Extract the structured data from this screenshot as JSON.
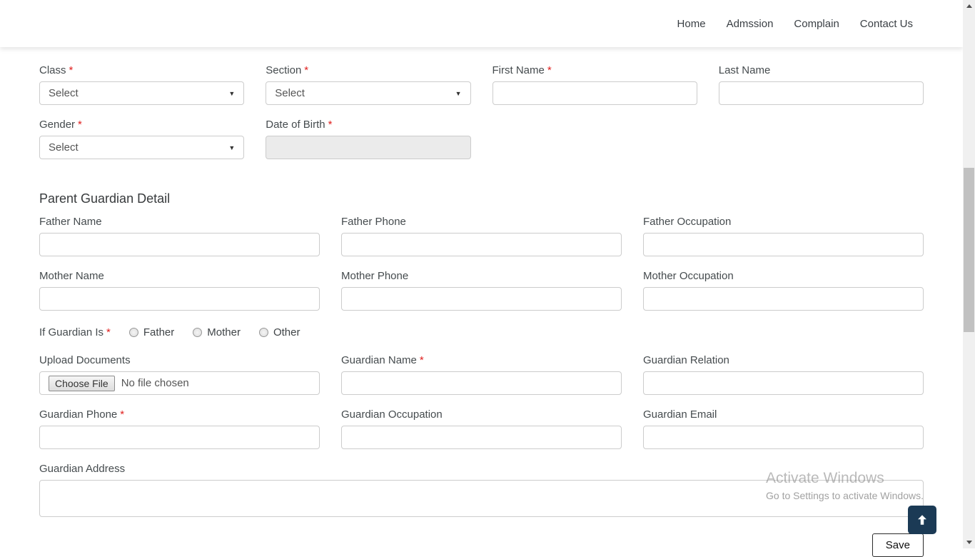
{
  "colors": {
    "accent_navy": "#1b3a55",
    "required_red": "#e0201f"
  },
  "nav": {
    "items": [
      "Home",
      "Admssion",
      "Complain",
      "Contact Us"
    ]
  },
  "form": {
    "required_marker": "*",
    "section_title": "Parent Guardian Detail",
    "fields": {
      "class": {
        "label": "Class",
        "value": "Select"
      },
      "section": {
        "label": "Section",
        "value": "Select"
      },
      "first_name": {
        "label": "First Name",
        "value": ""
      },
      "last_name": {
        "label": "Last Name",
        "value": ""
      },
      "gender": {
        "label": "Gender",
        "value": "Select"
      },
      "dob": {
        "label": "Date of Birth",
        "value": ""
      },
      "father_name": {
        "label": "Father Name",
        "value": ""
      },
      "father_phone": {
        "label": "Father Phone",
        "value": ""
      },
      "father_occupation": {
        "label": "Father Occupation",
        "value": ""
      },
      "mother_name": {
        "label": "Mother Name",
        "value": ""
      },
      "mother_phone": {
        "label": "Mother Phone",
        "value": ""
      },
      "mother_occupation": {
        "label": "Mother Occupation",
        "value": ""
      },
      "guardian_is": {
        "label": "If Guardian Is",
        "options": [
          "Father",
          "Mother",
          "Other"
        ]
      },
      "upload_documents": {
        "label": "Upload Documents",
        "button_label": "Choose File",
        "status_text": "No file chosen"
      },
      "guardian_name": {
        "label": "Guardian Name",
        "value": ""
      },
      "guardian_relation": {
        "label": "Guardian Relation",
        "value": ""
      },
      "guardian_phone": {
        "label": "Guardian Phone",
        "value": ""
      },
      "guardian_occupation": {
        "label": "Guardian Occupation",
        "value": ""
      },
      "guardian_email": {
        "label": "Guardian Email",
        "value": ""
      },
      "guardian_address": {
        "label": "Guardian Address",
        "value": ""
      }
    },
    "save_label": "Save"
  },
  "watermark": {
    "line1": "Activate Windows",
    "line2": "Go to Settings to activate Windows."
  }
}
